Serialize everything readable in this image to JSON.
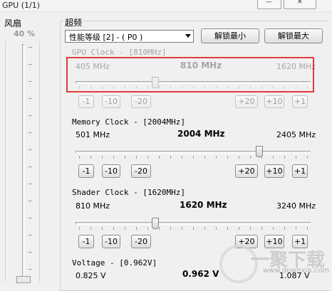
{
  "window": {
    "title": "GPU (1/1)",
    "minimize_glyph": "—",
    "close_glyph": "✕"
  },
  "fan": {
    "label": "风扇",
    "percent": "40 %",
    "disabled": true
  },
  "overclock": {
    "group_label": "超频",
    "perf_level_select": {
      "value": "性能等级 [2] - ( P0 )"
    },
    "unlock_min_label": "解锁最小",
    "unlock_max_label": "解锁最大",
    "highlight_color": "#e23b3b",
    "sliders": [
      {
        "title": "GPU Clock - [810MHz]",
        "min": "405 MHz",
        "current": "810 MHz",
        "max": "1620 MHz",
        "min_value": 405,
        "max_value": 1620,
        "value": 810,
        "disabled": true,
        "minus_buttons": [
          "-1",
          "-10",
          "-20"
        ],
        "plus_buttons": [
          "+20",
          "+10",
          "+1"
        ]
      },
      {
        "title": "Memory Clock - [2004MHz]",
        "min": "501 MHz",
        "current": "2004 MHz",
        "max": "2405 MHz",
        "min_value": 501,
        "max_value": 2405,
        "value": 2004,
        "disabled": false,
        "minus_buttons": [
          "-1",
          "-10",
          "-20"
        ],
        "plus_buttons": [
          "+20",
          "+10",
          "+1"
        ]
      },
      {
        "title": "Shader Clock - [1620MHz]",
        "min": "810 MHz",
        "current": "1620 MHz",
        "max": "3240 MHz",
        "min_value": 810,
        "max_value": 3240,
        "value": 1620,
        "disabled": false,
        "minus_buttons": [
          "-1",
          "-10",
          "-20"
        ],
        "plus_buttons": [
          "+20",
          "+10",
          "+1"
        ]
      },
      {
        "title": "Voltage - [0.962V]",
        "min": "0.825 V",
        "current": "0.962 V",
        "max": "1.087 V",
        "min_value": 0.825,
        "max_value": 1.087,
        "value": 0.962,
        "disabled": false
      }
    ]
  },
  "watermark": {
    "text": "一聚下载",
    "url": "www.downxia.com"
  }
}
